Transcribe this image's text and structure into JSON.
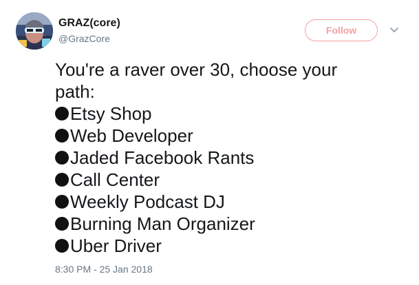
{
  "user": {
    "display_name": "GRAZ(core)",
    "handle": "@GrazCore"
  },
  "follow_label": "Follow",
  "tweet": {
    "intro_lines": [
      "You're a raver over 30, choose your",
      "path:"
    ],
    "options": [
      "Etsy Shop",
      "Web Developer",
      "Jaded Facebook Rants",
      "Call Center",
      "Weekly Podcast DJ",
      "Burning Man Organizer",
      "Uber Driver"
    ],
    "timestamp": "8:30 PM - 25 Jan 2018"
  },
  "colors": {
    "follow_accent": "#f4a0a0",
    "secondary_text": "#657786",
    "primary_text": "#14171a",
    "bullet": "#111111"
  },
  "icons": {
    "more": "chevron-down-icon",
    "bullet": "black-circle-icon"
  }
}
